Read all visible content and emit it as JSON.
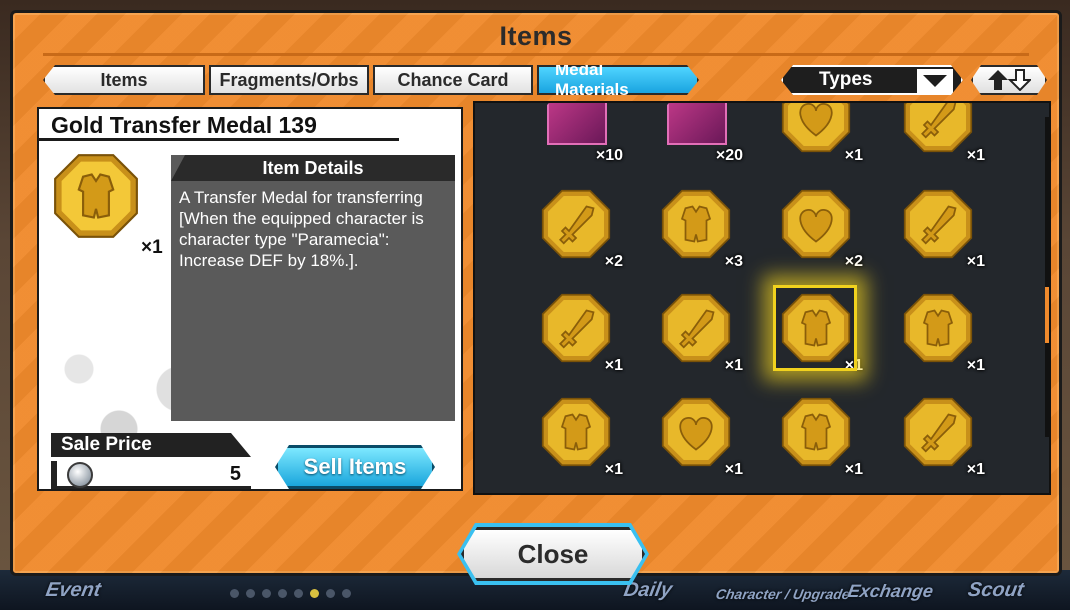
{
  "window": {
    "title": "Items"
  },
  "tabs": [
    {
      "label": "Items"
    },
    {
      "label": "Fragments/Orbs"
    },
    {
      "label": "Chance Card"
    },
    {
      "label": "Medal Materials",
      "active": true
    }
  ],
  "filter": {
    "label": "Types",
    "arrow": "chevron-down-icon"
  },
  "sort": {
    "label": "⬆⇩",
    "icon": "sort-icon"
  },
  "detail": {
    "name": "Gold Transfer Medal 139",
    "quantity": "×1",
    "medal_shape": "armor",
    "header": "Item Details",
    "description": "A Transfer Medal for transferring [When the equipped character is character type \"Paramecia\": Increase DEF by 18%.].",
    "sale_price_label": "Sale Price",
    "sale_price_value": "5",
    "sell_button": "Sell Items"
  },
  "grid": {
    "row0": [
      {
        "type": "character",
        "qty": "×10"
      },
      {
        "type": "character",
        "qty": "×20"
      },
      {
        "type": "heart",
        "qty": "×1"
      },
      {
        "type": "sword",
        "qty": "×1"
      }
    ],
    "row1": [
      {
        "type": "sword",
        "qty": "×2"
      },
      {
        "type": "armor",
        "qty": "×3"
      },
      {
        "type": "heart",
        "qty": "×2"
      },
      {
        "type": "sword",
        "qty": "×1"
      }
    ],
    "row2": [
      {
        "type": "sword",
        "qty": "×1"
      },
      {
        "type": "sword",
        "qty": "×1"
      },
      {
        "type": "armor",
        "qty": "×1",
        "selected": true
      },
      {
        "type": "armor",
        "qty": "×1"
      }
    ],
    "row3": [
      {
        "type": "armor",
        "qty": "×1"
      },
      {
        "type": "heart",
        "qty": "×1"
      },
      {
        "type": "armor",
        "qty": "×1"
      },
      {
        "type": "sword",
        "qty": "×1"
      }
    ]
  },
  "close_button": "Close",
  "bottom_nav": {
    "items": [
      "Event",
      "Daily",
      "Character / Upgrade",
      "Exchange",
      "Scout"
    ]
  },
  "colors": {
    "frame": "#f08a2c",
    "gold": "#e8b82a",
    "active_tab": "#1aa4e0",
    "selection": "#f1d21e"
  }
}
